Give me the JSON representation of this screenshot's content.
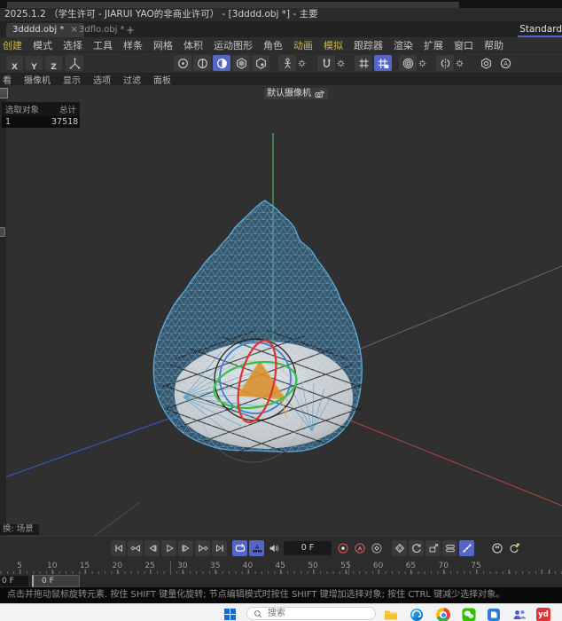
{
  "window": {
    "title": "2025.1.2 （学生许可 - JIARUI YAO的非商业许可） - [3dddd.obj *] - 主要"
  },
  "tabs": {
    "items": [
      {
        "label": "3dddd.obj *",
        "active": true
      },
      {
        "label": "3dflo.obj *",
        "active": false
      }
    ],
    "close_glyph": "×",
    "add": "+",
    "layout": "Standard"
  },
  "menus": {
    "items": [
      {
        "label": "创建",
        "accent": true
      },
      {
        "label": "模式"
      },
      {
        "label": "选择"
      },
      {
        "label": "工具"
      },
      {
        "label": "样条"
      },
      {
        "label": "网格"
      },
      {
        "label": "体积"
      },
      {
        "label": "运动图形"
      },
      {
        "label": "角色"
      },
      {
        "label": "动画",
        "accent": true
      },
      {
        "label": "模拟",
        "accent": true
      },
      {
        "label": "跟踪器"
      },
      {
        "label": "渲染"
      },
      {
        "label": "扩展"
      },
      {
        "label": "窗口"
      },
      {
        "label": "帮助"
      }
    ]
  },
  "toolbar": {
    "axes": [
      "X",
      "Y",
      "Z"
    ]
  },
  "viewport_menu": {
    "items": [
      "看",
      "摄像机",
      "显示",
      "选项",
      "过滤",
      "面板"
    ]
  },
  "viewport": {
    "camera_label": "默认摄像机",
    "hud": {
      "headers": [
        "选取对象",
        "总计"
      ],
      "row": [
        "1",
        "37518"
      ]
    },
    "take_label": "换: 场景"
  },
  "timeline": {
    "current_frame": "0 F",
    "range_start": "0 F",
    "playhead": "0 F",
    "ruler": [
      5,
      10,
      15,
      20,
      25,
      30,
      35,
      40,
      45,
      50,
      55,
      60,
      65,
      70,
      75
    ]
  },
  "status": {
    "text": "点击并拖动鼠标旋转元素. 按住 SHIFT 键量化旋转; 节点编辑模式时按住 SHIFT 键增加选择对象; 按住 CTRL 键减少选择对象。"
  },
  "taskbar": {
    "search_placeholder": "搜索",
    "youdao_label": "yd"
  },
  "colors": {
    "accent_blue": "#5565c8",
    "menu_accent": "#cdb54e",
    "record_red": "#d05050",
    "axis_x_red": "#c04848",
    "axis_y_green": "#4aa84a",
    "axis_z_blue": "#3c5bd0",
    "mesh_blue": "#4a9ccc",
    "selection_orange": "#d89030"
  }
}
